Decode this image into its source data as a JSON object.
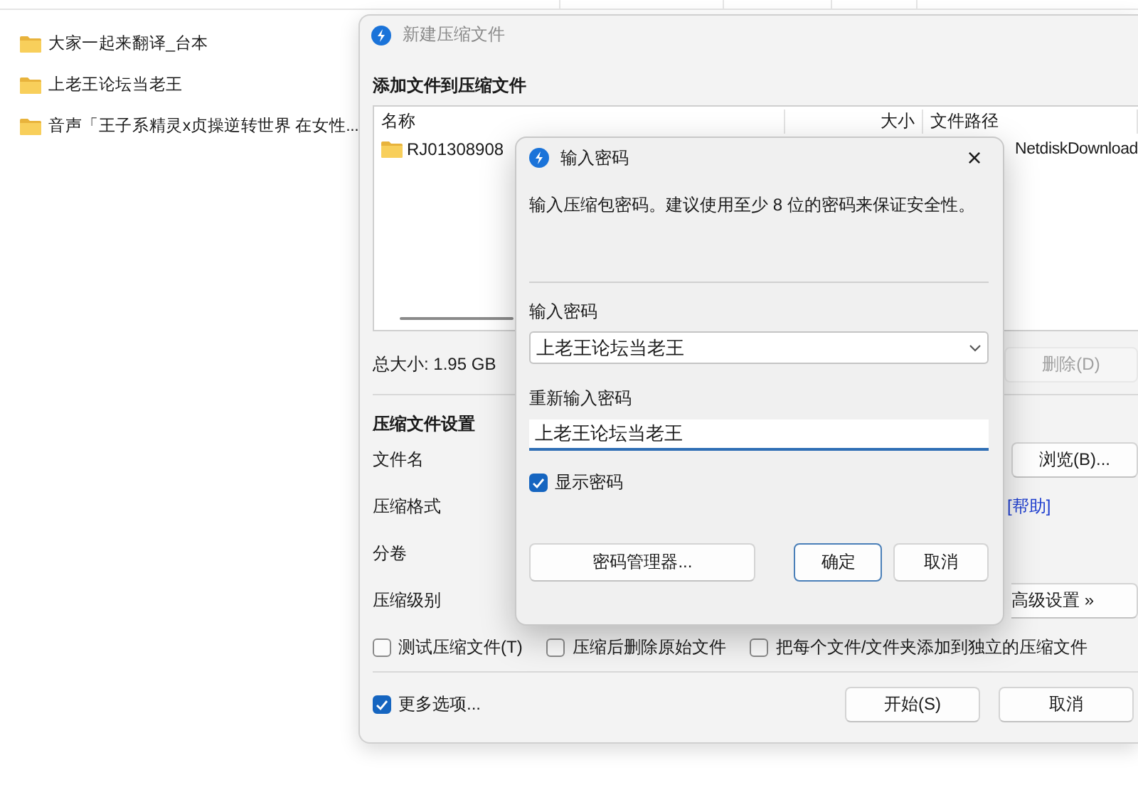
{
  "explorer": {
    "items": [
      {
        "name": "大家一起来翻译_台本"
      },
      {
        "name": "上老王论坛当老王"
      },
      {
        "name": "音声「王子系精灵x贞操逆转世界 在女性..."
      }
    ]
  },
  "archive_window": {
    "title": "新建压缩文件",
    "section_title": "添加文件到压缩文件",
    "file_list": {
      "columns": [
        "名称",
        "大小",
        "文件路径"
      ],
      "rows": [
        {
          "name": "RJ01308908",
          "path": "NetdiskDownload"
        }
      ]
    },
    "total_size": "总大小: 1.95 GB",
    "delete_button": {
      "label": "删除(D)",
      "disabled": true
    },
    "settings_title": "压缩文件设置",
    "fields": [
      "文件名",
      "压缩格式",
      "分卷",
      "压缩级别"
    ],
    "browse_button": "浏览(B)...",
    "help_link": "[帮助]",
    "advanced_button": "高级设置 »",
    "options": [
      {
        "label": "测试压缩文件(T)",
        "checked": false
      },
      {
        "label": "压缩后删除原始文件",
        "checked": false
      },
      {
        "label": "把每个文件/文件夹添加到独立的压缩文件",
        "checked": false
      }
    ],
    "more_options": {
      "label": "更多选项...",
      "checked": true
    },
    "buttons": [
      "开始(S)",
      "取消"
    ]
  },
  "password_dialog": {
    "title": "输入密码",
    "close": "×",
    "message": "输入压缩包密码。建议使用至少 8 位的密码来保证安全性。",
    "password_label": "输入密码",
    "password": "上老王论坛当老王",
    "confirm_label": "重新输入密码",
    "confirm": "上老王论坛当老王",
    "show_password": {
      "label": "显示密码",
      "checked": true
    },
    "buttons": [
      {
        "label": "密码管理器...",
        "default": false
      },
      {
        "label": "确定",
        "default": true
      },
      {
        "label": "取消",
        "default": false
      }
    ]
  }
}
